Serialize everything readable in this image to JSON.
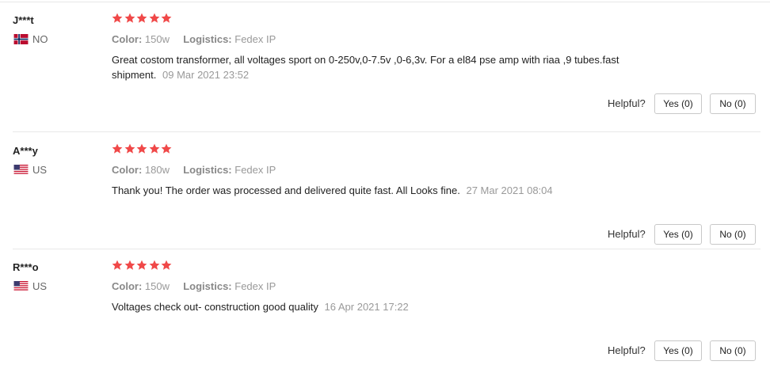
{
  "helpful_label": "Helpful?",
  "colors": {
    "star": "#f04848",
    "muted": "#999999"
  },
  "reviews": [
    {
      "user": "J***t",
      "country": "NO",
      "flag_icon": "norway-flag-icon",
      "rating": 5,
      "color_label": "Color:",
      "color_value": "150w",
      "logistics_label": "Logistics:",
      "logistics_value": "Fedex IP",
      "text": "Great costom transformer, all voltages sport on 0-250v,0-7.5v ,0-6,3v. For a el84 pse amp with riaa ,9 tubes.fast shipment.",
      "date": "09 Mar 2021 23:52",
      "yes_label": "Yes (0)",
      "no_label": "No (0)"
    },
    {
      "user": "A***y",
      "country": "US",
      "flag_icon": "us-flag-icon",
      "rating": 5,
      "color_label": "Color:",
      "color_value": "180w",
      "logistics_label": "Logistics:",
      "logistics_value": "Fedex IP",
      "text": "Thank you! The order was processed and delivered quite fast. All Looks fine.",
      "date": "27 Mar 2021 08:04",
      "yes_label": "Yes (0)",
      "no_label": "No (0)"
    },
    {
      "user": "R***o",
      "country": "US",
      "flag_icon": "us-flag-icon",
      "rating": 5,
      "color_label": "Color:",
      "color_value": "150w",
      "logistics_label": "Logistics:",
      "logistics_value": "Fedex IP",
      "text": "Voltages check out- construction good quality",
      "date": "16 Apr 2021 17:22",
      "yes_label": "Yes (0)",
      "no_label": "No (0)"
    }
  ]
}
